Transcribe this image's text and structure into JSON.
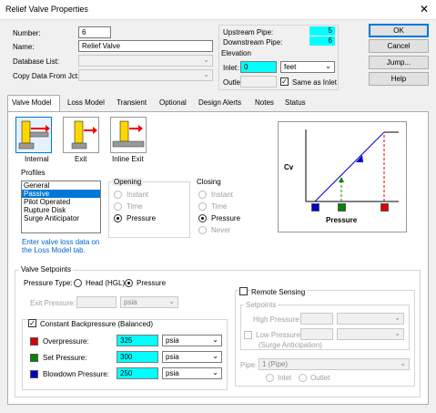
{
  "window": {
    "title": "Relief Valve Properties"
  },
  "fields": {
    "number_label": "Number:",
    "number_value": "6",
    "name_label": "Name:",
    "name_value": "Relief Valve",
    "database_label": "Database List:",
    "copy_label": "Copy Data From Jct..."
  },
  "pipes": {
    "upstream_label": "Upstream Pipe:",
    "upstream_value": "5",
    "downstream_label": "Downstream Pipe:",
    "downstream_value": "6"
  },
  "elevation": {
    "title": "Elevation",
    "inlet_label": "Inlet:",
    "inlet_value": "0",
    "unit": "feet",
    "outlet_label": "Outlet:",
    "same_as_inlet": "Same as Inlet"
  },
  "buttons": {
    "ok": "OK",
    "cancel": "Cancel",
    "jump": "Jump...",
    "help": "Help"
  },
  "tabs": [
    "Valve Model",
    "Loss Model",
    "Transient",
    "Optional",
    "Design Alerts",
    "Notes",
    "Status"
  ],
  "valve_types": [
    {
      "label": "Internal",
      "selected": true
    },
    {
      "label": "Exit",
      "selected": false
    },
    {
      "label": "Inline Exit",
      "selected": false
    }
  ],
  "profiles": {
    "title": "Profiles",
    "items": [
      "General",
      "Passive",
      "Pilot Operated",
      "Rupture Disk",
      "Surge Anticipator"
    ],
    "selected_index": 1,
    "note": "Enter valve loss data on the Loss Model tab."
  },
  "opening": {
    "title": "Opening",
    "options": [
      "Instant",
      "Time",
      "Pressure"
    ],
    "selected": "Pressure"
  },
  "closing": {
    "title": "Closing",
    "options": [
      "Instant",
      "Time",
      "Pressure",
      "Never"
    ],
    "selected": "Pressure"
  },
  "graph": {
    "ylabel": "Cv",
    "xlabel": "Pressure",
    "colors": {
      "blowdown": "#0000cc",
      "set": "#008800",
      "over": "#dd0000"
    }
  },
  "setpoints": {
    "title": "Valve Setpoints",
    "pressure_type_label": "Pressure Type:",
    "head_option": "Head (HGL)",
    "pressure_option": "Pressure",
    "exit_pressure_label": "Exit Pressure:",
    "exit_pressure_unit": "psia",
    "constant_backpressure": "Constant Backpressure (Balanced)",
    "overpressure_label": "Overpressure:",
    "overpressure_value": "325",
    "overpressure_unit": "psia",
    "set_label": "Set Pressure:",
    "set_value": "300",
    "set_unit": "psia",
    "blowdown_label": "Blowdown Pressure:",
    "blowdown_value": "250",
    "blowdown_unit": "psia"
  },
  "remote": {
    "title": "Remote Sensing",
    "setpoints_title": "Setpoints",
    "high_label": "High Pressure:",
    "low_label": "Low Pressure:",
    "surge_label": "(Surge Anticipation)",
    "pipe_label": "Pipe:",
    "pipe_value": "1 (Pipe)",
    "inlet_option": "Inlet",
    "outlet_option": "Outlet"
  }
}
